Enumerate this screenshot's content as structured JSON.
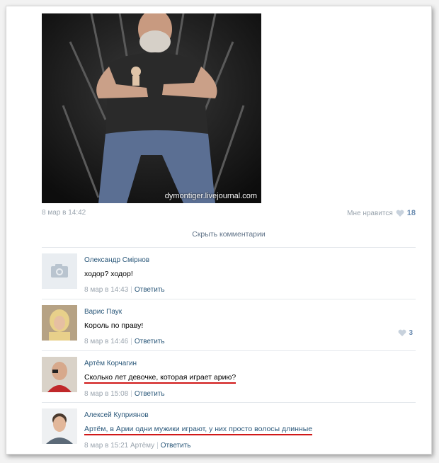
{
  "post": {
    "watermark": "dymontiger.livejournal.com",
    "date": "8 мар в 14:42",
    "likes_label": "Мне нравится",
    "likes_count": "18"
  },
  "hide_comments_label": "Скрыть комментарии",
  "reply_label": "Ответить",
  "comments": [
    {
      "author": "Олександр Смірнов",
      "text": "ходор? ходор!",
      "date": "8 мар в 14:43",
      "to": "",
      "likes": ""
    },
    {
      "author": "Варис Паук",
      "text": "Король по праву!",
      "date": "8 мар в 14:46",
      "to": "",
      "likes": "3"
    },
    {
      "author": "Артём Корчагин",
      "text": "Сколько лет девочке, которая играет арию?",
      "date": "8 мар в 15:08",
      "to": "",
      "likes": ""
    },
    {
      "author": "Алексей Куприянов",
      "text": "Артём, в Арии одни мужики играют, у них просто волосы длинные",
      "date": "8 мар в 15:21",
      "to": "Артёму",
      "likes": ""
    }
  ],
  "colors": {
    "link": "#2b587a",
    "meta": "#9aa4ae",
    "underline": "#d01818",
    "like_count": "#6a8bb0"
  },
  "icons": [
    "camera-icon",
    "heart-icon"
  ]
}
